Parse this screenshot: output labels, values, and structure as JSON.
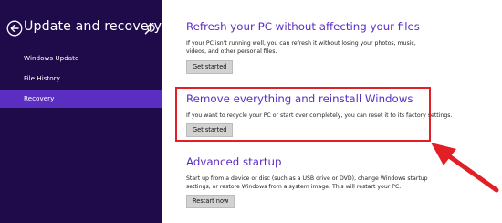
{
  "sidebar": {
    "title": "Update and recovery",
    "back_icon": "back-arrow-circle-icon",
    "search_icon": "search-icon",
    "items": [
      {
        "label": "Windows Update",
        "active": false
      },
      {
        "label": "File History",
        "active": false
      },
      {
        "label": "Recovery",
        "active": true
      }
    ]
  },
  "main": {
    "sections": [
      {
        "title": "Refresh your PC without affecting your files",
        "description": "If your PC isn't running well, you can refresh it without losing your photos, music, videos, and other personal files.",
        "button_label": "Get started"
      },
      {
        "title": "Remove everything and reinstall Windows",
        "description": "If you want to recycle your PC or start over completely, you can reset it to its factory settings.",
        "button_label": "Get started"
      },
      {
        "title": "Advanced startup",
        "description": "Start up from a device or disc (such as a USB drive or DVD), change Windows startup settings, or restore Windows from a system image. This will restart your PC.",
        "button_label": "Restart now"
      }
    ]
  },
  "colors": {
    "sidebar_bg": "#1f0a4a",
    "accent": "#5b2ec2",
    "annotation_red": "#e01f26"
  }
}
